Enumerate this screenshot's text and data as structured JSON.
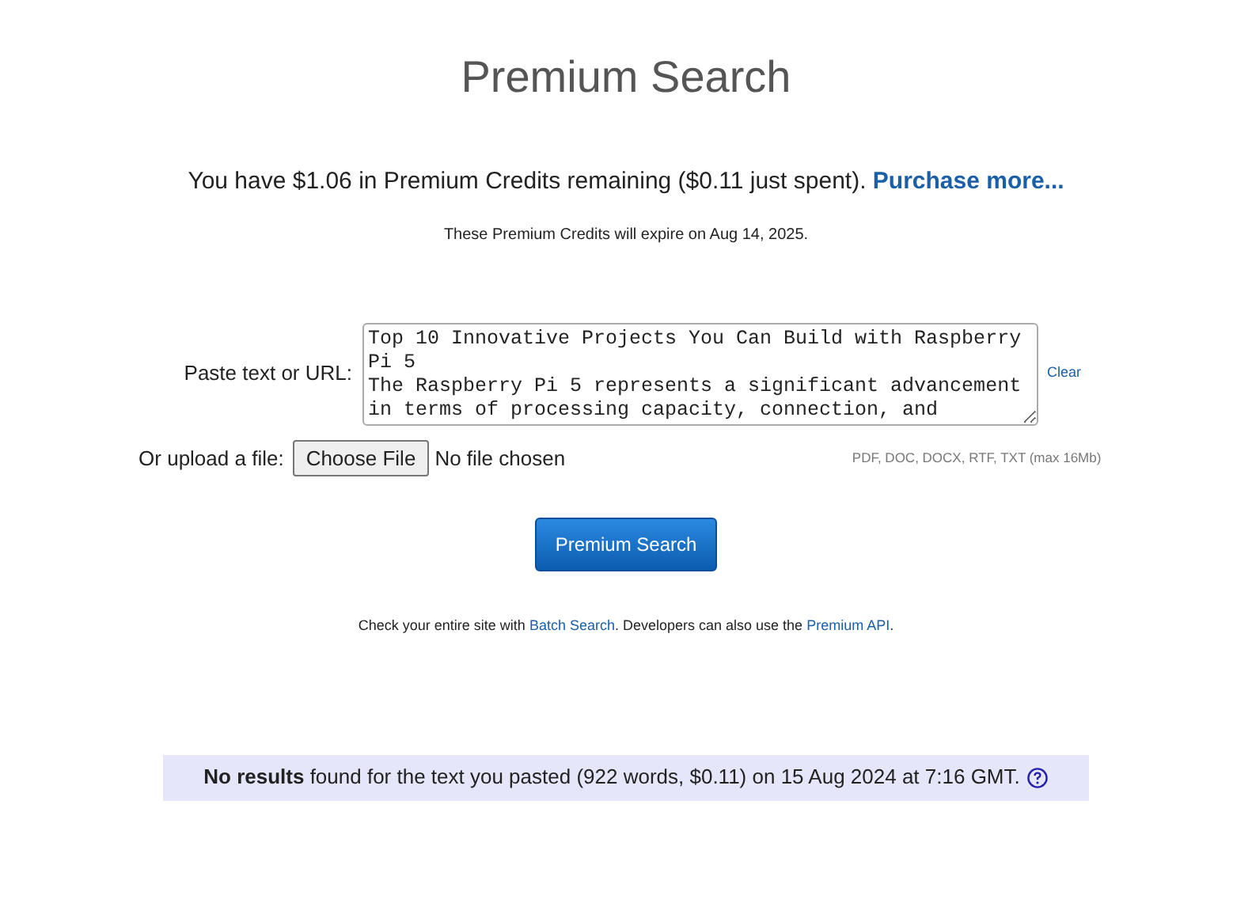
{
  "title": "Premium Search",
  "credits": {
    "text": "You have $1.06 in Premium Credits remaining ($0.11 just spent).",
    "link": "Purchase more..."
  },
  "expiry": "These Premium Credits will expire on Aug 14, 2025.",
  "paste": {
    "label": "Paste text or URL:",
    "value": "Top 10 Innovative Projects You Can Build with Raspberry Pi 5\nThe Raspberry Pi 5 represents a significant advancement in terms of processing capacity, connection, and",
    "clear": "Clear"
  },
  "upload": {
    "label": "Or upload a file:",
    "button": "Choose File",
    "status": "No file chosen",
    "hint": "PDF, DOC, DOCX, RTF, TXT (max 16Mb)"
  },
  "search_button": "Premium Search",
  "footer": {
    "before": "Check your entire site with",
    "link1": "Batch Search",
    "middle": ". Developers can also use the",
    "link2": "Premium API",
    "after": "."
  },
  "result": "**No results** found for the text you pasted (922 words, $0.11) on 15 Aug 2024 at 7:16 GMT."
}
